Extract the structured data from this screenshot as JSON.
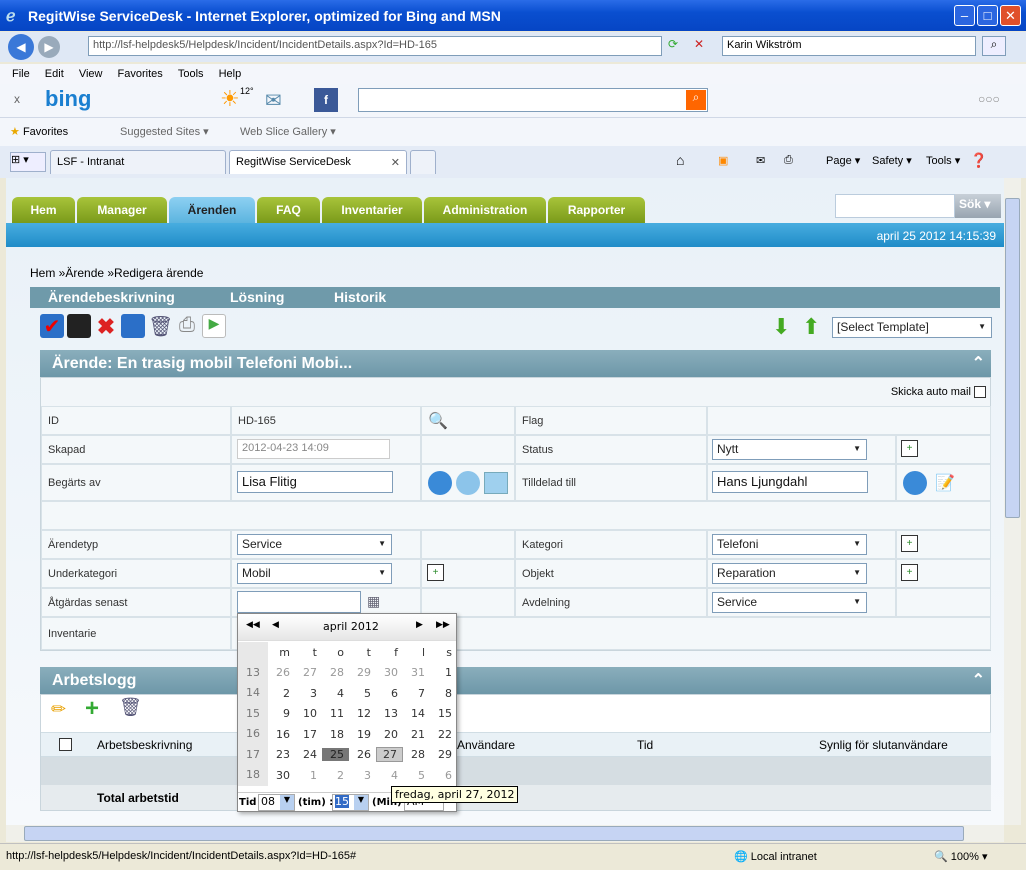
{
  "window": {
    "title": "RegitWise ServiceDesk - Internet Explorer, optimized for Bing and MSN"
  },
  "browser": {
    "url": "http://lsf-helpdesk5/Helpdesk/Incident/IncidentDetails.aspx?Id=HD-165",
    "search_value": "Karin Wikström",
    "menu": [
      "File",
      "Edit",
      "View",
      "Favorites",
      "Tools",
      "Help"
    ],
    "bing_label": "bing",
    "weather": "12°",
    "favorites_label": "Favorites",
    "suggested_sites": "Suggested Sites",
    "web_slice": "Web Slice Gallery",
    "tabs": [
      {
        "label": "LSF - Intranat"
      },
      {
        "label": "RegitWise ServiceDesk"
      }
    ],
    "cmd": {
      "page": "Page",
      "safety": "Safety",
      "tools": "Tools"
    },
    "status_url": "http://lsf-helpdesk5/Helpdesk/Incident/IncidentDetails.aspx?Id=HD-165#",
    "zone": "Local intranet",
    "zoom": "100%"
  },
  "nav": {
    "tabs": [
      "Hem",
      "Manager",
      "Ärenden",
      "FAQ",
      "Inventarier",
      "Administration",
      "Rapporter"
    ],
    "active": "Ärenden",
    "search_button": "Sök",
    "search_value": ""
  },
  "datetime": "april 25 2012 14:15:39",
  "breadcrumb": {
    "home": "Hem »",
    "mid": "Ärende »",
    "current": "Redigera ärende"
  },
  "subnav": [
    "Ärendebeskrivning",
    "Lösning",
    "Historik"
  ],
  "template_select": "[Select Template]",
  "incident": {
    "title": "Ärende: En trasig mobil Telefoni Mobi...",
    "auto_mail_label": "Skicka auto mail",
    "id_label": "ID",
    "id_value": "HD-165",
    "flag_label": "Flag",
    "created_label": "Skapad",
    "created_value": "2012-04-23 14:09",
    "status_label": "Status",
    "status_value": "Nytt",
    "requested_label": "Begärts av",
    "requested_value": "Lisa Flitig",
    "assigned_label": "Tilldelad till",
    "assigned_value": "Hans Ljungdahl",
    "type_label": "Ärendetyp",
    "type_value": "Service",
    "category_label": "Kategori",
    "category_value": "Telefoni",
    "subcategory_label": "Underkategori",
    "subcategory_value": "Mobil",
    "object_label": "Objekt",
    "object_value": "Reparation",
    "due_label": "Åtgärdas senast",
    "due_value": "",
    "department_label": "Avdelning",
    "department_value": "Service",
    "inventory_label": "Inventarie"
  },
  "worklog": {
    "title": "Arbetslogg",
    "columns": [
      "Arbetsbeskrivning",
      "Användare",
      "Tid",
      "Synlig för slutanvändare"
    ],
    "total_label": "Total arbetstid"
  },
  "calendar": {
    "month": "april 2012",
    "weekdays": [
      "m",
      "t",
      "o",
      "t",
      "f",
      "l",
      "s"
    ],
    "weeks": [
      {
        "wk": "13",
        "days": [
          "26",
          "27",
          "28",
          "29",
          "30",
          "31",
          "1"
        ]
      },
      {
        "wk": "14",
        "days": [
          "2",
          "3",
          "4",
          "5",
          "6",
          "7",
          "8"
        ]
      },
      {
        "wk": "15",
        "days": [
          "9",
          "10",
          "11",
          "12",
          "13",
          "14",
          "15"
        ]
      },
      {
        "wk": "16",
        "days": [
          "16",
          "17",
          "18",
          "19",
          "20",
          "21",
          "22"
        ]
      },
      {
        "wk": "17",
        "days": [
          "23",
          "24",
          "25",
          "26",
          "27",
          "28",
          "29"
        ]
      },
      {
        "wk": "18",
        "days": [
          "30",
          "1",
          "2",
          "3",
          "4",
          "5",
          "6"
        ]
      }
    ],
    "today": "25",
    "hover": "27",
    "time_label": "Tid",
    "hour": "08",
    "hour_unit": "(tim) :",
    "minute": "15",
    "minute_unit": "(Min)",
    "ampm": "AM",
    "tooltip": "fredag, april 27, 2012"
  }
}
